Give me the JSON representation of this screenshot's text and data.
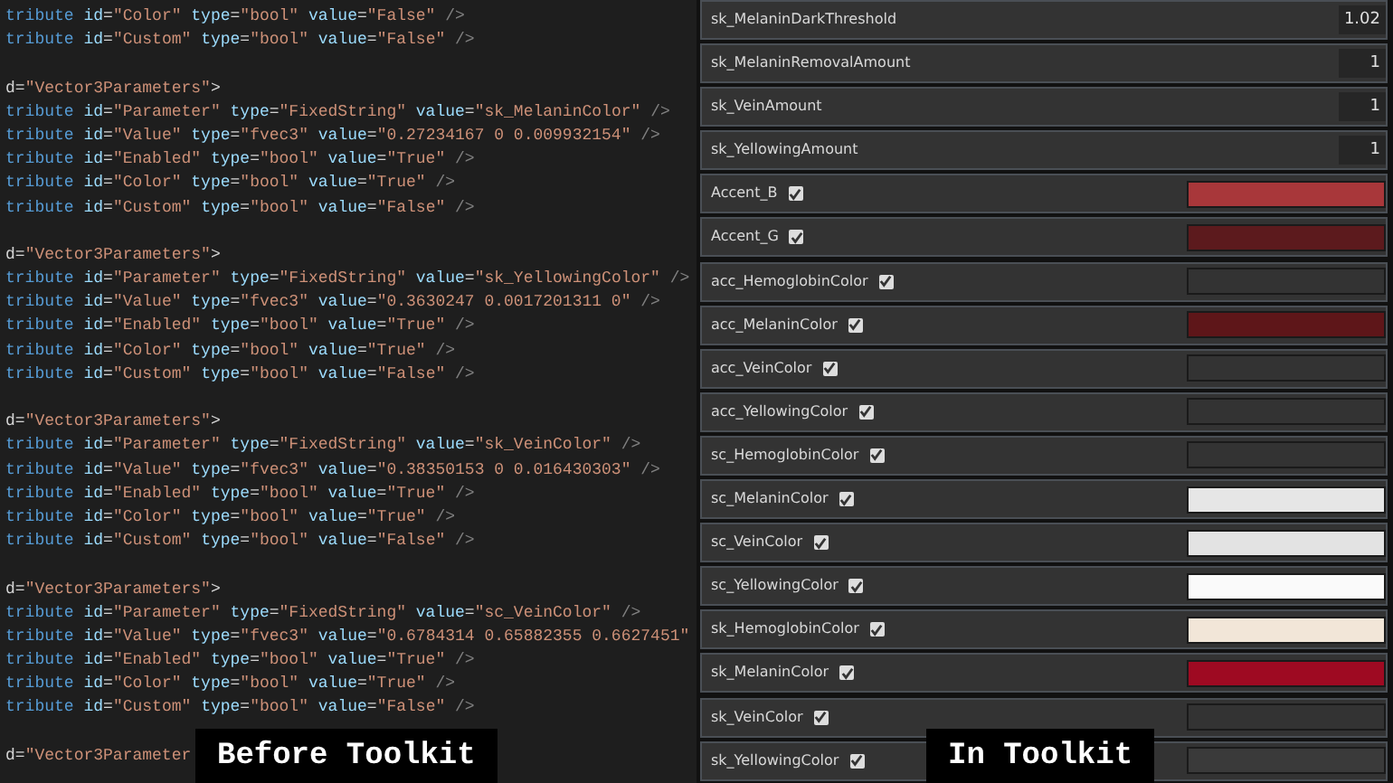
{
  "code_editor": {
    "blocks": [
      {
        "lines": [
          "tribute id=\"Color\" type=\"bool\" value=\"False\" />",
          "tribute id=\"Custom\" type=\"bool\" value=\"False\" />"
        ]
      },
      {
        "lines": [
          "d=\"Vector3Parameters\">",
          "tribute id=\"Parameter\" type=\"FixedString\" value=\"sk_MelaninColor\" />",
          "tribute id=\"Value\" type=\"fvec3\" value=\"0.27234167 0 0.009932154\" />",
          "tribute id=\"Enabled\" type=\"bool\" value=\"True\" />",
          "tribute id=\"Color\" type=\"bool\" value=\"True\" />",
          "tribute id=\"Custom\" type=\"bool\" value=\"False\" />"
        ]
      },
      {
        "lines": [
          "d=\"Vector3Parameters\">",
          "tribute id=\"Parameter\" type=\"FixedString\" value=\"sk_YellowingColor\" />",
          "tribute id=\"Value\" type=\"fvec3\" value=\"0.3630247 0.0017201311 0\" />",
          "tribute id=\"Enabled\" type=\"bool\" value=\"True\" />",
          "tribute id=\"Color\" type=\"bool\" value=\"True\" />",
          "tribute id=\"Custom\" type=\"bool\" value=\"False\" />"
        ]
      },
      {
        "lines": [
          "d=\"Vector3Parameters\">",
          "tribute id=\"Parameter\" type=\"FixedString\" value=\"sk_VeinColor\" />",
          "tribute id=\"Value\" type=\"fvec3\" value=\"0.38350153 0 0.016430303\" />",
          "tribute id=\"Enabled\" type=\"bool\" value=\"True\" />",
          "tribute id=\"Color\" type=\"bool\" value=\"True\" />",
          "tribute id=\"Custom\" type=\"bool\" value=\"False\" />"
        ]
      },
      {
        "lines": [
          "d=\"Vector3Parameters\">",
          "tribute id=\"Parameter\" type=\"FixedString\" value=\"sc_VeinColor\" />",
          "tribute id=\"Value\" type=\"fvec3\" value=\"0.6784314 0.65882355 0.6627451\"",
          "tribute id=\"Enabled\" type=\"bool\" value=\"True\" />",
          "tribute id=\"Color\" type=\"bool\" value=\"True\" />",
          "tribute id=\"Custom\" type=\"bool\" value=\"False\" />"
        ]
      },
      {
        "lines": [
          "d=\"Vector3Parameter"
        ]
      }
    ],
    "caption": "Before Toolkit"
  },
  "toolkit": {
    "parameters": [
      {
        "kind": "number",
        "label": "sk_MelaninDarkThreshold",
        "value": "1.02"
      },
      {
        "kind": "number",
        "label": "sk_MelaninRemovalAmount",
        "value": "1"
      },
      {
        "kind": "number",
        "label": "sk_VeinAmount",
        "value": "1"
      },
      {
        "kind": "number",
        "label": "sk_YellowingAmount",
        "value": "1"
      },
      {
        "kind": "color",
        "label": "Accent_B",
        "checked": true,
        "color": "#a8373a"
      },
      {
        "kind": "color",
        "label": "Accent_G",
        "checked": true,
        "color": "#5c1a1d"
      },
      {
        "kind": "color",
        "label": "acc_HemoglobinColor",
        "checked": true,
        "color": "#333333"
      },
      {
        "kind": "color",
        "label": "acc_MelaninColor",
        "checked": true,
        "color": "#5e1619"
      },
      {
        "kind": "color",
        "label": "acc_VeinColor",
        "checked": true,
        "color": "#333333"
      },
      {
        "kind": "color",
        "label": "acc_YellowingColor",
        "checked": true,
        "color": "#333333"
      },
      {
        "kind": "color",
        "label": "sc_HemoglobinColor",
        "checked": true,
        "color": "#333333"
      },
      {
        "kind": "color",
        "label": "sc_MelaninColor",
        "checked": true,
        "color": "#e6e6e6"
      },
      {
        "kind": "color",
        "label": "sc_VeinColor",
        "checked": true,
        "color": "#e3e3e3"
      },
      {
        "kind": "color",
        "label": "sc_YellowingColor",
        "checked": true,
        "color": "#fafafa"
      },
      {
        "kind": "color",
        "label": "sk_HemoglobinColor",
        "checked": true,
        "color": "#f2e6d8"
      },
      {
        "kind": "color",
        "label": "sk_MelaninColor",
        "checked": true,
        "color": "#9e0a22"
      },
      {
        "kind": "color",
        "label": "sk_VeinColor",
        "checked": true,
        "color": "#333333"
      },
      {
        "kind": "color",
        "label": "sk_YellowingColor",
        "checked": true,
        "color": "#3a3a3a"
      }
    ],
    "caption": "In Toolkit"
  }
}
